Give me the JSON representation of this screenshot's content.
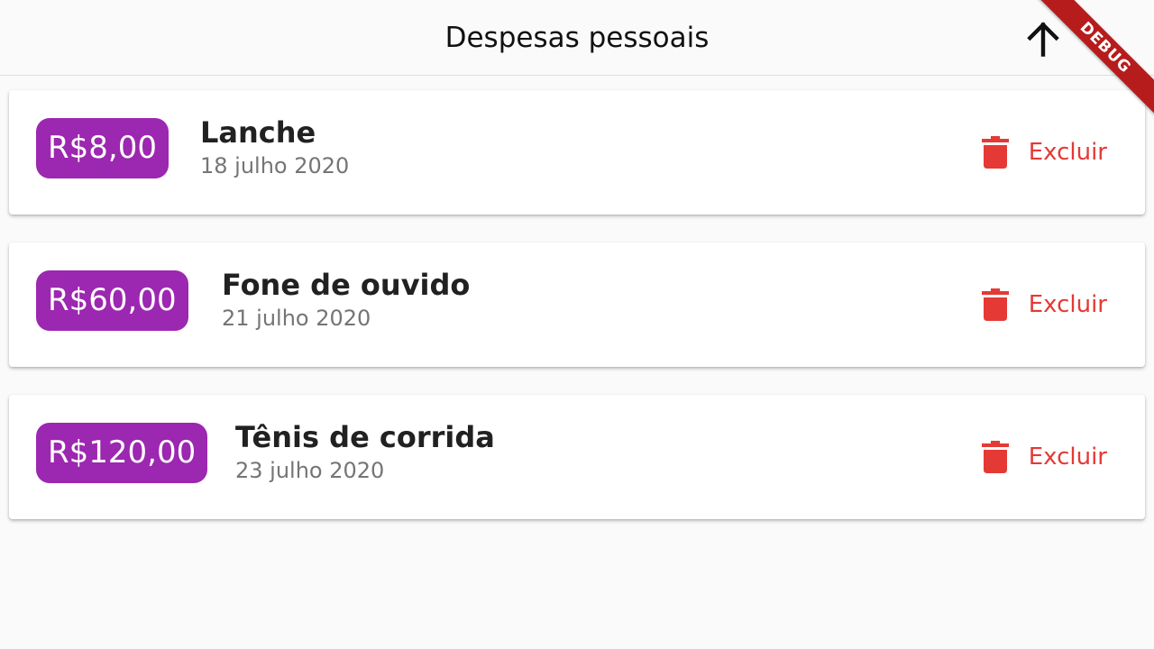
{
  "app_bar": {
    "title": "Despesas pessoais",
    "actions": [
      {
        "icon": "arrow-upward-icon"
      },
      {
        "icon": "add-icon"
      }
    ],
    "debug_label": "DEBUG"
  },
  "transactions": [
    {
      "value": "R$8,00",
      "title": "Lanche",
      "date": "18 julho 2020",
      "delete_label": "Excluir"
    },
    {
      "value": "R$60,00",
      "title": "Fone de ouvido",
      "date": "21 julho 2020",
      "delete_label": "Excluir"
    },
    {
      "value": "R$120,00",
      "title": "Tênis de corrida",
      "date": "23 julho 2020",
      "delete_label": "Excluir"
    }
  ],
  "colors": {
    "primary": "#9c27b0",
    "error": "#e53935",
    "debug": "#b71c1c",
    "background": "#fafafa"
  }
}
